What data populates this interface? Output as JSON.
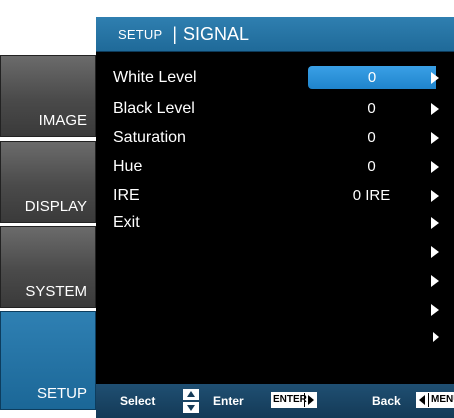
{
  "title": {
    "section": "SETUP",
    "separator": "|",
    "page": "SIGNAL"
  },
  "nav": [
    {
      "label": "IMAGE",
      "active": false
    },
    {
      "label": "DISPLAY",
      "active": false
    },
    {
      "label": "SYSTEM",
      "active": false
    },
    {
      "label": "SETUP",
      "active": true
    }
  ],
  "rows": [
    {
      "label": "White Level",
      "value": "0",
      "selected": true
    },
    {
      "label": "Black Level",
      "value": "0"
    },
    {
      "label": "Saturation",
      "value": "0"
    },
    {
      "label": "Hue",
      "value": "0"
    },
    {
      "label": "IRE",
      "value": "0 IRE"
    },
    {
      "label": "Exit",
      "value": ""
    },
    {
      "label": "",
      "value": ""
    },
    {
      "label": "",
      "value": ""
    },
    {
      "label": "",
      "value": ""
    },
    {
      "label": "",
      "value": ""
    }
  ],
  "footer": {
    "select": "Select",
    "enter": "Enter",
    "enter_key": "ENTER",
    "back": "Back",
    "menu_key": "MENU"
  },
  "colors": {
    "accent": "#1f84cc",
    "title_bar": "#2a78a8",
    "panel": "#000000"
  }
}
